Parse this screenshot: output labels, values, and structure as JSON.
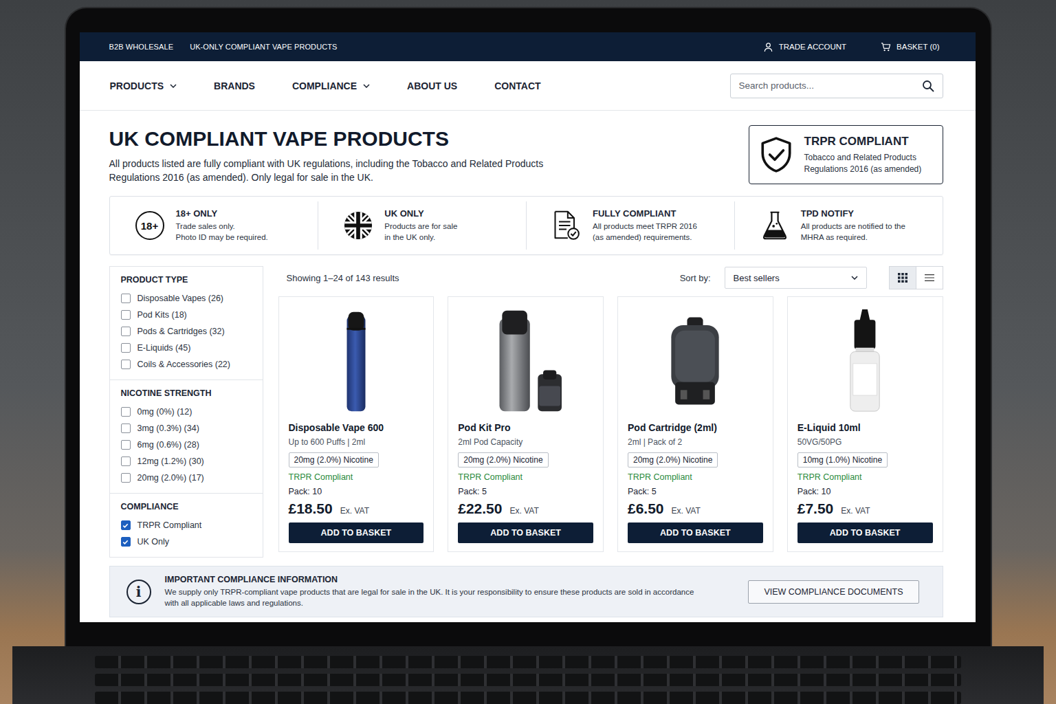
{
  "topbar": {
    "labels": [
      "B2B WHOLESALE",
      "UK-ONLY COMPLIANT VAPE PRODUCTS"
    ],
    "account": "TRADE ACCOUNT",
    "basket": "BASKET (0)"
  },
  "nav": {
    "items": [
      {
        "label": "PRODUCTS",
        "dropdown": true
      },
      {
        "label": "BRANDS",
        "dropdown": false
      },
      {
        "label": "COMPLIANCE",
        "dropdown": true
      },
      {
        "label": "ABOUT US",
        "dropdown": false
      },
      {
        "label": "CONTACT",
        "dropdown": false
      }
    ],
    "search": {
      "placeholder": "Search products..."
    }
  },
  "hero": {
    "title": "UK COMPLIANT VAPE PRODUCTS",
    "description": "All products listed are fully compliant with UK regulations, including the Tobacco and Related Products Regulations 2016 (as amended). Only legal for sale in the UK.",
    "badge": {
      "title": "TRPR COMPLIANT",
      "lines": [
        "Tobacco and Related Products",
        "Regulations 2016 (as amended)"
      ]
    }
  },
  "features": [
    {
      "kind": "age",
      "badge": "18+",
      "title": "18+ ONLY",
      "lines": [
        "Trade sales only.",
        "Photo ID may be required."
      ]
    },
    {
      "kind": "flag",
      "title": "UK ONLY",
      "lines": [
        "Products are for sale",
        "in the UK only."
      ]
    },
    {
      "kind": "document",
      "title": "FULLY COMPLIANT",
      "lines": [
        "All products meet TRPR 2016",
        "(as amended) requirements."
      ]
    },
    {
      "kind": "flask",
      "title": "TPD NOTIFY",
      "lines": [
        "All products are notified to the",
        "MHRA as required."
      ]
    }
  ],
  "filters": [
    {
      "title": "PRODUCT TYPE",
      "options": [
        {
          "label": "Disposable Vapes (26)",
          "checked": false
        },
        {
          "label": "Pod Kits (18)",
          "checked": false
        },
        {
          "label": "Pods & Cartridges (32)",
          "checked": false
        },
        {
          "label": "E-Liquids (45)",
          "checked": false
        },
        {
          "label": "Coils & Accessories (22)",
          "checked": false
        }
      ]
    },
    {
      "title": "NICOTINE STRENGTH",
      "options": [
        {
          "label": "0mg (0%) (12)",
          "checked": false
        },
        {
          "label": "3mg (0.3%) (34)",
          "checked": false
        },
        {
          "label": "6mg (0.6%) (28)",
          "checked": false
        },
        {
          "label": "12mg (1.2%) (30)",
          "checked": false
        },
        {
          "label": "20mg (2.0%) (17)",
          "checked": false
        }
      ]
    },
    {
      "title": "COMPLIANCE",
      "options": [
        {
          "label": "TRPR Compliant",
          "checked": true
        },
        {
          "label": "UK Only",
          "checked": true
        }
      ]
    }
  ],
  "results": {
    "summary": "Showing 1–24 of 143 results",
    "sort_label": "Sort by:",
    "sort_value": "Best sellers",
    "views": [
      {
        "kind": "grid",
        "selected": true
      },
      {
        "kind": "list",
        "selected": false
      }
    ]
  },
  "products": [
    {
      "kind": "disposable",
      "name": "Disposable Vape 600",
      "detail": "Up to 600 Puffs | 2ml",
      "nicotine": "20mg (2.0%) Nicotine",
      "compliance": "TRPR Compliant",
      "pack": "Pack: 10",
      "price": "£18.50",
      "vat": "Ex. VAT",
      "button": "ADD TO BASKET"
    },
    {
      "kind": "podkit",
      "name": "Pod Kit Pro",
      "detail": "2ml Pod Capacity",
      "nicotine": "20mg (2.0%) Nicotine",
      "compliance": "TRPR Compliant",
      "pack": "Pack: 5",
      "price": "£22.50",
      "vat": "Ex. VAT",
      "button": "ADD TO BASKET"
    },
    {
      "kind": "cartridge",
      "name": "Pod Cartridge (2ml)",
      "detail": "2ml | Pack of 2",
      "nicotine": "20mg (2.0%) Nicotine",
      "compliance": "TRPR Compliant",
      "pack": "Pack: 5",
      "price": "£6.50",
      "vat": "Ex. VAT",
      "button": "ADD TO BASKET"
    },
    {
      "kind": "bottle",
      "name": "E-Liquid 10ml",
      "detail": "50VG/50PG",
      "nicotine": "10mg (1.0%) Nicotine",
      "compliance": "TRPR Compliant",
      "pack": "Pack: 10",
      "price": "£7.50",
      "vat": "Ex. VAT",
      "button": "ADD TO BASKET"
    }
  ],
  "notice": {
    "icon": "i",
    "title": "IMPORTANT COMPLIANCE INFORMATION",
    "text": "We supply only TRPR-compliant vape products that are legal for sale in the UK. It is your responsibility to ensure these products are sold in accordance with all applicable laws and regulations.",
    "button": "VIEW COMPLIANCE DOCUMENTS"
  }
}
